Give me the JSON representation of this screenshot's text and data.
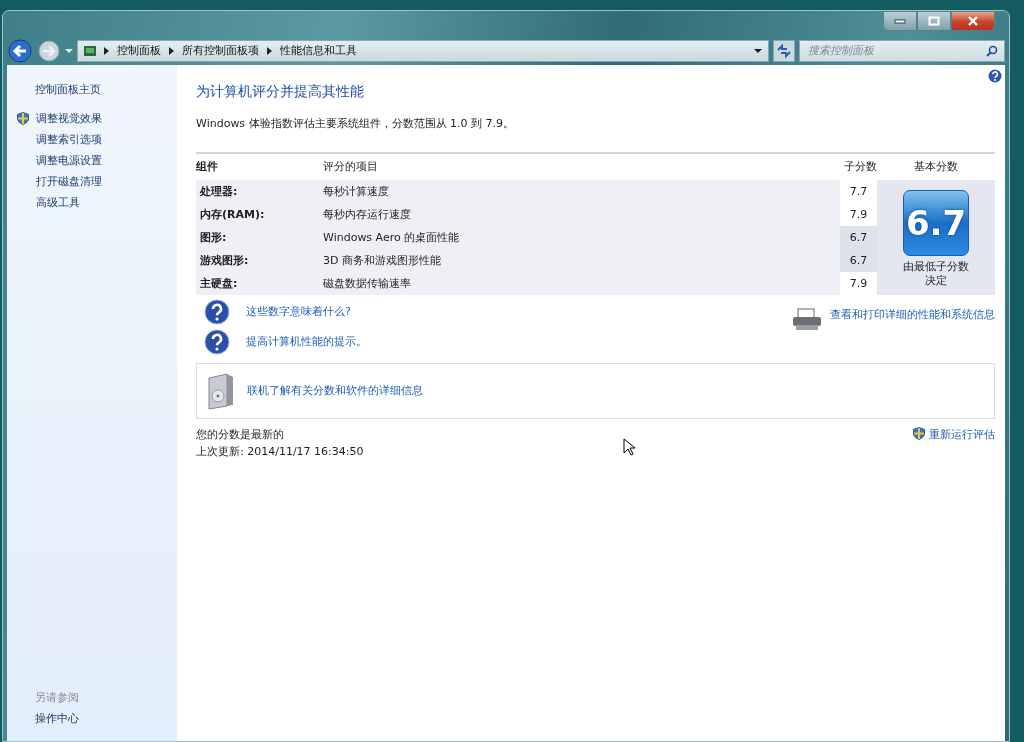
{
  "address_bar": {
    "breadcrumbs": [
      "控制面板",
      "所有控制面板项",
      "性能信息和工具"
    ]
  },
  "search": {
    "placeholder": "搜索控制面板"
  },
  "sidebar": {
    "home": "控制面板主页",
    "items": [
      {
        "label": "调整视觉效果",
        "kind": "shield"
      },
      {
        "label": "调整索引选项",
        "kind": "plain"
      },
      {
        "label": "调整电源设置",
        "kind": "plain"
      },
      {
        "label": "打开磁盘清理",
        "kind": "plain"
      },
      {
        "label": "高级工具",
        "kind": "plain"
      }
    ],
    "see_also": {
      "heading": "另请参阅",
      "items": [
        "操作中心"
      ]
    }
  },
  "main": {
    "title": "为计算机评分并提高其性能",
    "description": "Windows 体验指数评估主要系统组件，分数范围从 1.0 到 7.9。",
    "table": {
      "columns": [
        "组件",
        "评分的项目",
        "子分数",
        "基本分数"
      ],
      "rows": [
        {
          "component": "处理器:",
          "item": "每秒计算速度",
          "subscore": "7.7",
          "lowest": false
        },
        {
          "component": "内存(RAM):",
          "item": "每秒内存运行速度",
          "subscore": "7.9",
          "lowest": false
        },
        {
          "component": "图形:",
          "item": "Windows Aero 的桌面性能",
          "subscore": "6.7",
          "lowest": true
        },
        {
          "component": "游戏图形:",
          "item": "3D 商务和游戏图形性能",
          "subscore": "6.7",
          "lowest": true
        },
        {
          "component": "主硬盘:",
          "item": "磁盘数据传输速率",
          "subscore": "7.9",
          "lowest": false
        }
      ],
      "base_score": {
        "value": "6.7",
        "caption": "由最低子分数决定"
      }
    },
    "help_links": [
      "这些数字意味着什么?",
      "提高计算机性能的提示。"
    ],
    "print_link": "查看和打印详细的性能和系统信息",
    "online_link": "联机了解有关分数和软件的详细信息",
    "status": "您的分数是最新的",
    "last_updated": "上次更新: 2014/11/17 16:34:50",
    "rerun_link": "重新运行评估"
  }
}
